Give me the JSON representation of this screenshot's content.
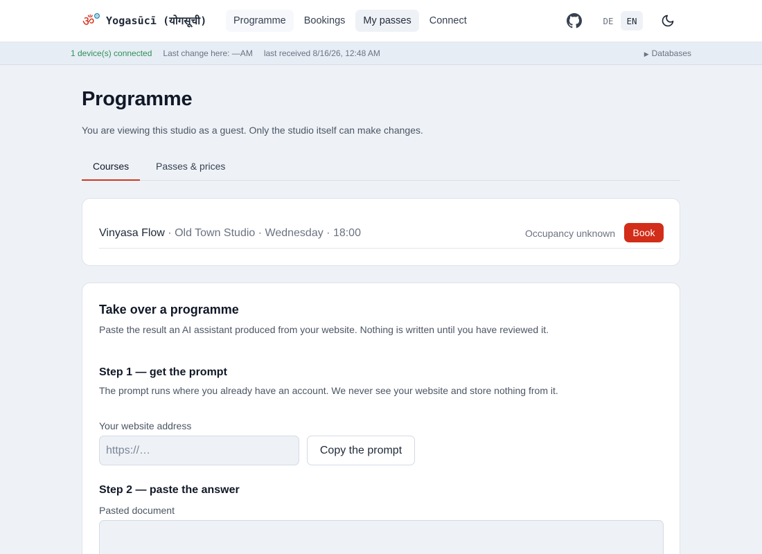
{
  "brand": {
    "name": "Yogasūcī (योगसूची)",
    "logo_icon": "om-icon"
  },
  "nav": {
    "items": [
      {
        "label": "Programme"
      },
      {
        "label": "Bookings"
      },
      {
        "label": "My passes"
      },
      {
        "label": "Connect"
      }
    ],
    "active": "My passes"
  },
  "header_actions": {
    "github_icon": "github-icon",
    "languages": [
      "DE",
      "EN"
    ],
    "active_language": "EN",
    "theme_icon": "moon-icon"
  },
  "status": {
    "connected": "1 device(s) connected",
    "last_change": "Last change here: —AM",
    "last_received": "last received 8/16/26, 12:48 AM",
    "databases": "Databases"
  },
  "page": {
    "title": "Programme",
    "guest_note": "You are viewing this studio as a guest. Only the studio itself can make changes."
  },
  "tabs": [
    {
      "label": "Courses",
      "active": true
    },
    {
      "label": "Passes & prices",
      "active": false
    }
  ],
  "course": {
    "name": "Vinyasa Flow",
    "details": " · Old Town Studio · Wednesday · 18:00",
    "occupancy": "Occupancy unknown",
    "book_label": "Book"
  },
  "takeover": {
    "title": "Take over a programme",
    "description": "Paste the result an AI assistant produced from your website. Nothing is written until you have reviewed it.",
    "step1_title": "Step 1 — get the prompt",
    "step1_text": "The prompt runs where you already have an account. We never see your website and store nothing from it.",
    "website_label": "Your website address",
    "website_placeholder": "https://…",
    "website_value": "",
    "copy_label": "Copy the prompt",
    "step2_title": "Step 2 — paste the answer",
    "pasted_label": "Pasted document",
    "pasted_value": ""
  },
  "colors": {
    "accent": "#d22d19",
    "connected": "#2f8f57",
    "background": "#eef2f7"
  }
}
